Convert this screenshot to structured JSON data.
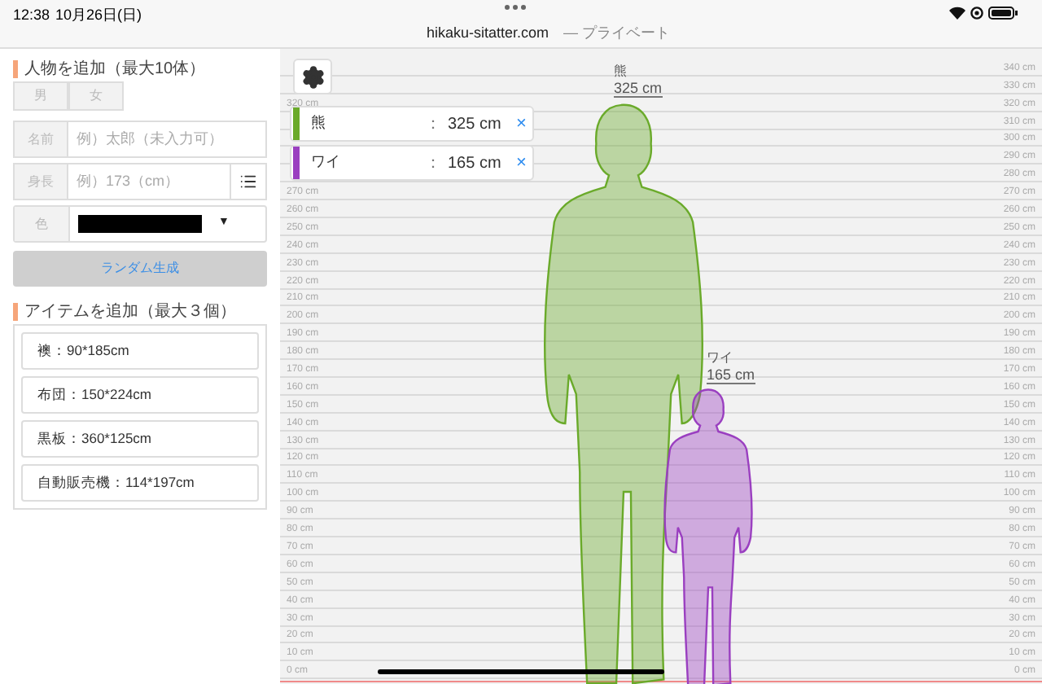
{
  "status_bar": {
    "time": "12:38",
    "date": "10月26日(日)",
    "url": "hikaku-sitatter.com",
    "url_note": "— プライベート"
  },
  "add_person": {
    "title": "人物を追加（最大10体）",
    "genders": [
      {
        "label": "男",
        "selected": false
      },
      {
        "label": "女",
        "selected": false
      }
    ],
    "name_label": "名前",
    "name_placeholder": "例）太郎（未入力可）",
    "height_label": "身長",
    "height_placeholder": "例）173（cm）",
    "color_label": "色",
    "color": "#000000",
    "color_caret": "▼",
    "random_button": "ランダム生成"
  },
  "add_item": {
    "title": "アイテムを追加（最大３個）",
    "items": [
      "襖：90*185cm",
      "布団：150*224cm",
      "黒板：360*125cm",
      "自動販売機：114*197cm"
    ]
  },
  "people": [
    {
      "name": "熊",
      "colon": "：",
      "height": "325 cm",
      "remove": "×",
      "color": "#6aaa2a",
      "figure_name": "熊",
      "figure_height": "325 cm"
    },
    {
      "name": "ワイ",
      "colon": "：",
      "height": "165 cm",
      "remove": "×",
      "color": "#9a3fc0",
      "figure_name": "ワイ",
      "figure_height": "165 cm"
    }
  ],
  "ruler": [
    {
      "right": "340 cm"
    },
    {
      "right": "330 cm"
    },
    {
      "left": "320 cm",
      "right": "320 cm"
    },
    {
      "right": "310 cm"
    },
    {
      "right": "300 cm"
    },
    {
      "right": "290 cm"
    },
    {
      "right": "280 cm"
    },
    {
      "left": "270 cm",
      "right": "270 cm"
    },
    {
      "left": "260 cm",
      "right": "260 cm"
    },
    {
      "left": "250 cm",
      "right": "250 cm"
    },
    {
      "left": "240 cm",
      "right": "240 cm"
    },
    {
      "left": "230 cm",
      "right": "230 cm"
    },
    {
      "left": "220 cm",
      "right": "220 cm"
    },
    {
      "left": "210 cm",
      "right": "210 cm"
    },
    {
      "left": "200 cm",
      "right": "200 cm"
    },
    {
      "left": "190 cm",
      "right": "190 cm"
    },
    {
      "left": "180 cm",
      "right": "180 cm"
    },
    {
      "left": "170 cm",
      "right": "170 cm"
    },
    {
      "left": "160 cm",
      "right": "160 cm"
    },
    {
      "left": "150 cm",
      "right": "150 cm"
    },
    {
      "left": "140 cm",
      "right": "140 cm"
    },
    {
      "left": "130 cm",
      "right": "130 cm"
    },
    {
      "left": "120 cm",
      "right": "120 cm"
    },
    {
      "left": "110 cm",
      "right": "110 cm"
    },
    {
      "left": "100 cm",
      "right": "100 cm"
    },
    {
      "left": "90 cm",
      "right": "90 cm"
    },
    {
      "left": "80 cm",
      "right": "80 cm"
    },
    {
      "left": "70 cm",
      "right": "70 cm"
    },
    {
      "left": "60 cm",
      "right": "60 cm"
    },
    {
      "left": "50 cm",
      "right": "50 cm"
    },
    {
      "left": "40 cm",
      "right": "40 cm"
    },
    {
      "left": "30 cm",
      "right": "30 cm"
    },
    {
      "left": "20 cm",
      "right": "20 cm"
    },
    {
      "left": "10 cm",
      "right": "10 cm"
    },
    {
      "left": "0 cm",
      "right": "0 cm"
    }
  ]
}
